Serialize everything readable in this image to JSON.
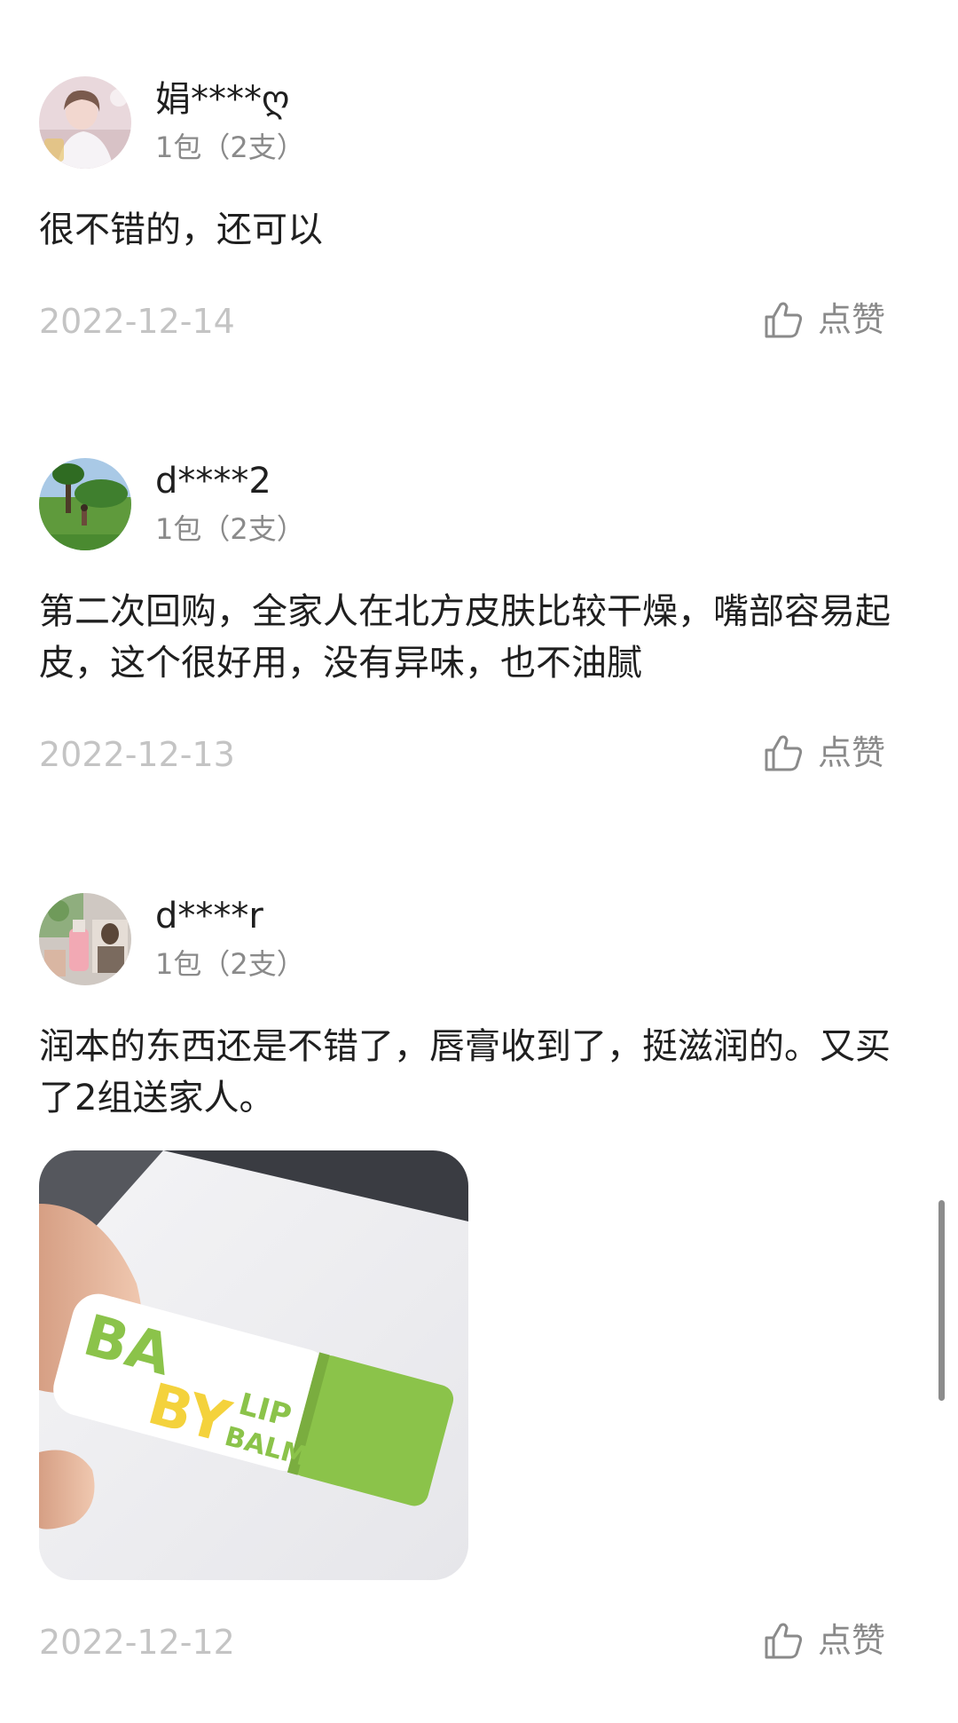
{
  "reviews": [
    {
      "username": "娟****ღ",
      "variant": "1包（2支）",
      "content": "很不错的，还可以",
      "date": "2022-12-14",
      "like_label": "点赞"
    },
    {
      "username": "d****2",
      "variant": "1包（2支）",
      "content": "第二次回购，全家人在北方皮肤比较干燥，嘴部容易起皮，这个很好用，没有异味，也不油腻",
      "date": "2022-12-13",
      "like_label": "点赞"
    },
    {
      "username": "d****r",
      "variant": "1包（2支）",
      "content": "润本的东西还是不错了，唇膏收到了，挺滋润的。又买了2组送家人。",
      "date": "2022-12-12",
      "like_label": "点赞",
      "photo": {
        "product_text": [
          "BA",
          "BY",
          "LIP",
          "BALM"
        ]
      }
    }
  ],
  "colors": {
    "date": "#c4c4c4",
    "secondary": "#8a8a8a",
    "primary_text": "#1f1f1f",
    "product_green": "#8bc34a",
    "product_yellow": "#f4d23c"
  },
  "icons": {
    "like": "thumbs-up-icon"
  }
}
